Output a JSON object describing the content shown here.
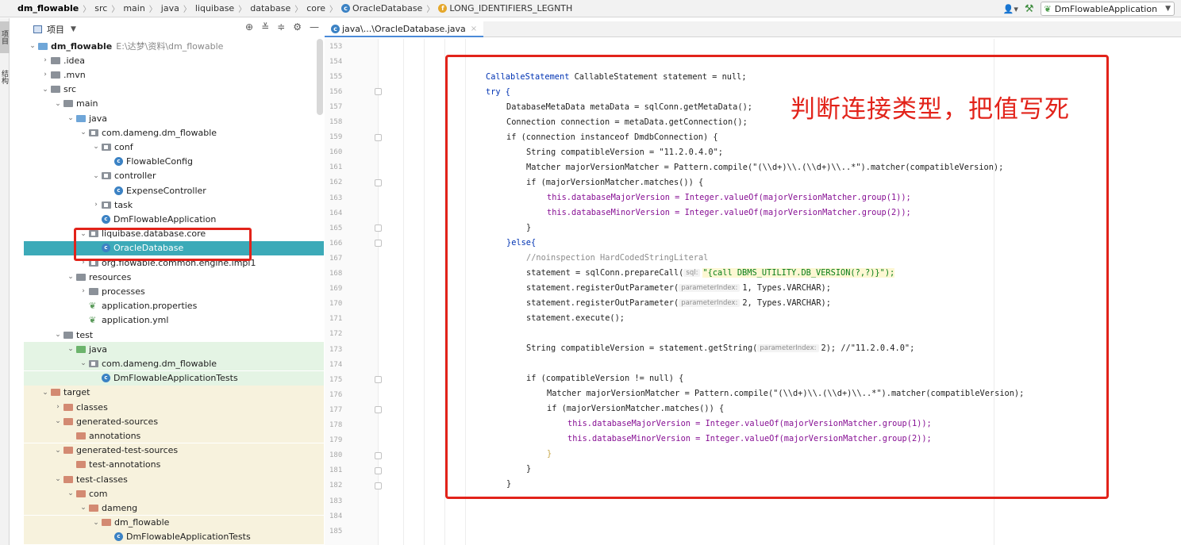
{
  "breadcrumb": {
    "items": [
      "dm_flowable",
      "src",
      "main",
      "java",
      "liquibase",
      "database",
      "core",
      "OracleDatabase",
      "LONG_IDENTIFIERS_LEGNTH"
    ]
  },
  "toolbar": {
    "run_config": "DmFlowableApplication"
  },
  "left_stripe": {
    "project_tab": "项目",
    "structure_tab": "结构"
  },
  "project_panel": {
    "title": "项目",
    "tree": [
      {
        "label": "dm_flowable",
        "hint": "E:\\达梦\\资料\\dm_flowable",
        "arrow": "v",
        "icon": "fold-blue",
        "indent": 0
      },
      {
        "label": ".idea",
        "arrow": ">",
        "icon": "fold",
        "indent": 1
      },
      {
        "label": ".mvn",
        "arrow": ">",
        "icon": "fold",
        "indent": 1
      },
      {
        "label": "src",
        "arrow": "v",
        "icon": "fold",
        "indent": 1
      },
      {
        "label": "main",
        "arrow": "v",
        "icon": "fold",
        "indent": 2
      },
      {
        "label": "java",
        "arrow": "v",
        "icon": "fold-blue",
        "indent": 3
      },
      {
        "label": "com.dameng.dm_flowable",
        "arrow": "v",
        "icon": "pkg",
        "indent": 4
      },
      {
        "label": "conf",
        "arrow": "v",
        "icon": "pkg",
        "indent": 5
      },
      {
        "label": "FlowableConfig",
        "arrow": "",
        "icon": "cls",
        "indent": 6
      },
      {
        "label": "controller",
        "arrow": "v",
        "icon": "pkg",
        "indent": 5
      },
      {
        "label": "ExpenseController",
        "arrow": "",
        "icon": "cls",
        "indent": 6
      },
      {
        "label": "task",
        "arrow": ">",
        "icon": "pkg",
        "indent": 5
      },
      {
        "label": "DmFlowableApplication",
        "arrow": "",
        "icon": "cls",
        "indent": 5
      },
      {
        "label": "liquibase.database.core",
        "arrow": "v",
        "icon": "pkg",
        "indent": 4
      },
      {
        "label": "OracleDatabase",
        "arrow": "",
        "icon": "cls",
        "indent": 5
      },
      {
        "label": "org.flowable.common.engine.impl1",
        "arrow": ">",
        "icon": "pkg",
        "indent": 4
      },
      {
        "label": "resources",
        "arrow": "v",
        "icon": "fold",
        "indent": 3
      },
      {
        "label": "processes",
        "arrow": ">",
        "icon": "fold",
        "indent": 4
      },
      {
        "label": "application.properties",
        "arrow": "",
        "icon": "prop",
        "indent": 4
      },
      {
        "label": "application.yml",
        "arrow": "",
        "icon": "prop",
        "indent": 4
      },
      {
        "label": "test",
        "arrow": "v",
        "icon": "fold",
        "indent": 2
      },
      {
        "label": "java",
        "arrow": "v",
        "icon": "fold-green",
        "indent": 3
      },
      {
        "label": "com.dameng.dm_flowable",
        "arrow": "v",
        "icon": "pkg",
        "indent": 4
      },
      {
        "label": "DmFlowableApplicationTests",
        "arrow": "",
        "icon": "cls",
        "indent": 5
      },
      {
        "label": "target",
        "arrow": "v",
        "icon": "fold-red",
        "indent": 1
      },
      {
        "label": "classes",
        "arrow": ">",
        "icon": "fold-red",
        "indent": 2
      },
      {
        "label": "generated-sources",
        "arrow": "v",
        "icon": "fold-red",
        "indent": 2
      },
      {
        "label": "annotations",
        "arrow": "",
        "icon": "fold-red",
        "indent": 3
      },
      {
        "label": "generated-test-sources",
        "arrow": "v",
        "icon": "fold-red",
        "indent": 2
      },
      {
        "label": "test-annotations",
        "arrow": "",
        "icon": "fold-red",
        "indent": 3
      },
      {
        "label": "test-classes",
        "arrow": "v",
        "icon": "fold-red",
        "indent": 2
      },
      {
        "label": "com",
        "arrow": "v",
        "icon": "fold-red",
        "indent": 3
      },
      {
        "label": "dameng",
        "arrow": "v",
        "icon": "fold-red",
        "indent": 4
      },
      {
        "label": "dm_flowable",
        "arrow": "v",
        "icon": "fold-red",
        "indent": 5
      },
      {
        "label": "DmFlowableApplicationTests",
        "arrow": "",
        "icon": "cls",
        "indent": 6
      }
    ]
  },
  "editor": {
    "tab_label": "java\\...\\OracleDatabase.java",
    "line_numbers": [
      "153",
      "154",
      "155",
      "156",
      "157",
      "158",
      "159",
      "160",
      "161",
      "162",
      "163",
      "164",
      "165",
      "166",
      "167",
      "168",
      "169",
      "170",
      "171",
      "172",
      "173",
      "174",
      "175",
      "176",
      "177",
      "178",
      "179",
      "180",
      "181",
      "182",
      "183",
      "184",
      "185"
    ],
    "annotation": "判断连接类型，把值写死",
    "code": {
      "l155": "CallableStatement statement = null;",
      "l156": "try {",
      "l157": "DatabaseMetaData metaData = sqlConn.getMetaData();",
      "l158": "Connection connection = metaData.getConnection();",
      "l159": "if (connection instanceof DmdbConnection) {",
      "l160": "String compatibleVersion = \"11.2.0.4.0\";",
      "l161": "Matcher majorVersionMatcher = Pattern.compile(\"(\\\\d+)\\\\.(\\\\d+)\\\\..*\").matcher(compatibleVersion);",
      "l162": "if (majorVersionMatcher.matches()) {",
      "l163": "this.databaseMajorVersion = Integer.valueOf(majorVersionMatcher.group(1));",
      "l164": "this.databaseMinorVersion = Integer.valueOf(majorVersionMatcher.group(2));",
      "l165": "}",
      "l166": "}else{",
      "l167": "//noinspection HardCodedStringLiteral",
      "l168_pre": "statement = sqlConn.prepareCall(",
      "l168_hint": "sql:",
      "l168_post": "\"{call DBMS_UTILITY.DB_VERSION(?,?)}\");",
      "l169_pre": "statement.registerOutParameter(",
      "l169_hint": "parameterIndex:",
      "l169_post": "1, Types.VARCHAR);",
      "l170_pre": "statement.registerOutParameter(",
      "l170_hint": "parameterIndex:",
      "l170_post": "2, Types.VARCHAR);",
      "l171": "statement.execute();",
      "l173_pre": "String compatibleVersion = statement.getString(",
      "l173_hint": "parameterIndex:",
      "l173_post": "2); //\"11.2.0.4.0\";",
      "l175": "if (compatibleVersion != null) {",
      "l176": "Matcher majorVersionMatcher = Pattern.compile(\"(\\\\d+)\\\\.(\\\\d+)\\\\..*\").matcher(compatibleVersion);",
      "l177": "if (majorVersionMatcher.matches()) {",
      "l178": "this.databaseMajorVersion = Integer.valueOf(majorVersionMatcher.group(1));",
      "l179": "this.databaseMinorVersion = Integer.valueOf(majorVersionMatcher.group(2));",
      "l180": "}",
      "l181": "}",
      "l182": "}"
    }
  }
}
